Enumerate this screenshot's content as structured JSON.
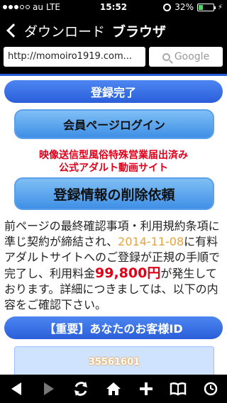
{
  "status_bar": {
    "carrier": "au",
    "network": "LTE",
    "time": "15:52",
    "battery_percent": "32%",
    "battery_level": 0.32
  },
  "nav": {
    "back_label": "ダウンロード",
    "title": "ブラウザ"
  },
  "address_bar": {
    "url": "http://momoiro1919.com...",
    "search_placeholder": "Google"
  },
  "content": {
    "banner_complete": "登録完了",
    "member_login_button": "会員ページログイン",
    "notice_line1": "映像送信型風俗特殊営業届出済み",
    "notice_line2": "公式アダルト動画サイト",
    "delete_request_button": "登録情報の削除依頼",
    "para_part1": "前ページの最終確認事項・利用規約条項に準じ契約が締結され、",
    "para_date": "2014-11-08",
    "para_part2": "に有料アダルトサイトへのご登録が正規の手順で完了し、利用料金",
    "para_price": "99,800円",
    "para_part3": "が発生しております。詳細につきましては、以下の内容をご確認下さい。",
    "id_banner": "【重要】あなたのお客様ID",
    "customer_id": "35561601"
  },
  "colors": {
    "accent_blue": "#2a5ed9",
    "warning_red": "#e0001a",
    "date_orange": "#e9a23b"
  },
  "toolbar": {
    "icons": [
      "back-icon",
      "forward-icon",
      "reload-icon",
      "home-icon",
      "add-icon",
      "bookmarks-icon",
      "history-icon"
    ]
  }
}
